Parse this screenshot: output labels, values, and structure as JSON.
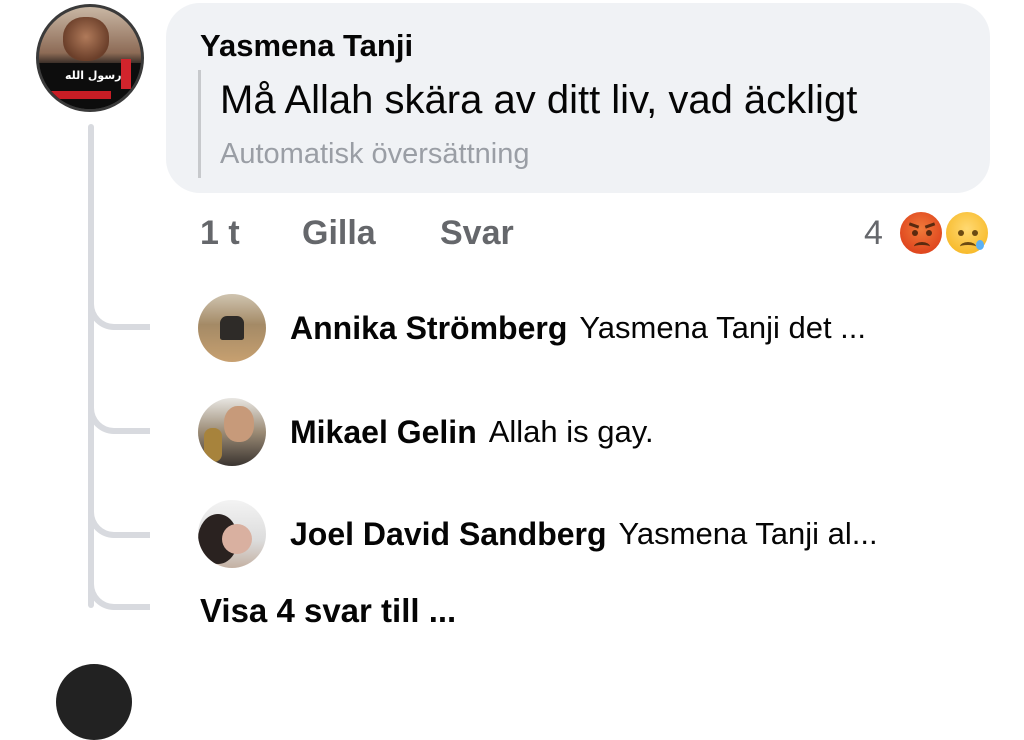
{
  "comment": {
    "author": "Yasmena Tanji",
    "text": "Må Allah skära av ditt liv, vad äckligt",
    "translation_label": "Automatisk översättning",
    "avatar_text": "رسول الله",
    "time": "1 t",
    "like_label": "Gilla",
    "reply_label": "Svar",
    "reaction_count": "4",
    "reactions": [
      "angry-emoji",
      "sad-emoji"
    ]
  },
  "replies": [
    {
      "name": "Annika Strömberg",
      "text": "Yasmena Tanji det ..."
    },
    {
      "name": "Mikael Gelin",
      "text": "Allah is gay."
    },
    {
      "name": "Joel David Sandberg",
      "text": "Yasmena Tanji al..."
    }
  ],
  "more_replies_label": "Visa 4 svar till ...",
  "colors": {
    "bubble": "#f0f2f5",
    "secondary_text": "#65676b",
    "thread_line": "#d8dadf"
  }
}
